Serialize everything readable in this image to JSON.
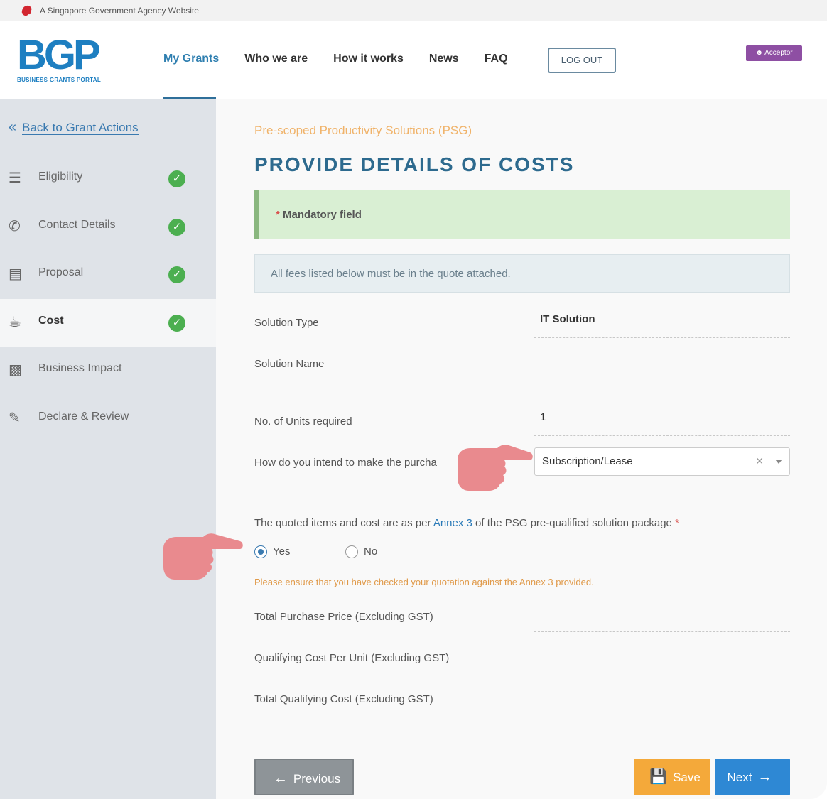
{
  "gov_banner": {
    "text": "A Singapore Government Agency Website"
  },
  "header": {
    "logo_text": "BGP",
    "logo_subtitle": "BUSINESS GRANTS PORTAL",
    "nav": [
      {
        "label": "My Grants"
      },
      {
        "label": "Who we are"
      },
      {
        "label": "How it works"
      },
      {
        "label": "News"
      },
      {
        "label": "FAQ"
      }
    ],
    "logout_label": "LOG OUT",
    "user_badge": "Acceptor"
  },
  "sidebar": {
    "back_label": "Back to Grant Actions",
    "steps": [
      {
        "label": "Eligibility",
        "icon": "list-icon",
        "complete": true
      },
      {
        "label": "Contact Details",
        "icon": "phone-icon",
        "complete": true
      },
      {
        "label": "Proposal",
        "icon": "document-icon",
        "complete": true
      },
      {
        "label": "Cost",
        "icon": "piggy-bank-icon",
        "complete": true
      },
      {
        "label": "Business Impact",
        "icon": "chart-icon",
        "complete": false
      },
      {
        "label": "Declare & Review",
        "icon": "pen-icon",
        "complete": false
      }
    ]
  },
  "main": {
    "scheme": "Pre-scoped Productivity Solutions (PSG)",
    "title": "PROVIDE DETAILS OF COSTS",
    "mandatory_note": "Mandatory field",
    "info_note": "All fees listed below must be in the quote attached.",
    "fields": {
      "solution_type_label": "Solution Type",
      "solution_type_value": "IT Solution",
      "solution_name_label": "Solution Name",
      "solution_name_value": "",
      "units_label": "No. of Units required",
      "units_value": "1",
      "purchase_label": "How do you intend to make the purcha",
      "purchase_value": "Subscription/Lease",
      "total_price_label": "Total Purchase Price (Excluding GST)",
      "qualifying_unit_label": "Qualifying Cost Per Unit (Excluding GST)",
      "total_qualifying_label": "Total Qualifying Cost (Excluding GST)"
    },
    "question": {
      "prefix": "The quoted items and cost are as per ",
      "link": "Annex 3",
      "suffix": " of the PSG pre-qualified solution package",
      "yes": "Yes",
      "no": "No",
      "selected": "Yes"
    },
    "warning": "Please ensure that you have checked your quotation against the Annex 3 provided.",
    "buttons": {
      "previous": "Previous",
      "save": "Save",
      "next": "Next"
    }
  },
  "colors": {
    "accent": "#2d6a8e",
    "success": "#4caf50",
    "save": "#f4a93a",
    "next": "#2e88d4",
    "pointer_hand": "#e98a8e"
  }
}
